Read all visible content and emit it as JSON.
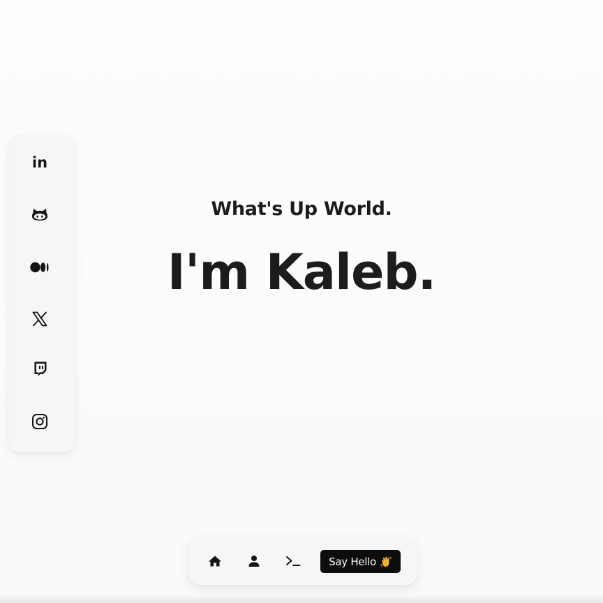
{
  "sidebar": {
    "links": [
      {
        "name": "linkedin",
        "icon": "linkedin-icon",
        "glyph": "in"
      },
      {
        "name": "github",
        "icon": "github-icon"
      },
      {
        "name": "medium",
        "icon": "medium-icon"
      },
      {
        "name": "x",
        "icon": "x-icon"
      },
      {
        "name": "twitch",
        "icon": "twitch-icon"
      },
      {
        "name": "instagram",
        "icon": "instagram-icon"
      }
    ]
  },
  "hero": {
    "subtitle": "What's Up World.",
    "title": "I'm Kaleb."
  },
  "nav": {
    "items": [
      {
        "icon": "home-icon"
      },
      {
        "icon": "user-icon"
      },
      {
        "icon": "terminal-icon"
      }
    ],
    "say_hello_label": "Say Hello",
    "say_hello_emoji": "👋"
  },
  "colors": {
    "background": "#fbfbfb",
    "panel": "#f6f6f6",
    "text": "#1c1c1c",
    "button": "#0d0d0d",
    "button_text": "#ffffff",
    "emoji": "#f2b233"
  }
}
